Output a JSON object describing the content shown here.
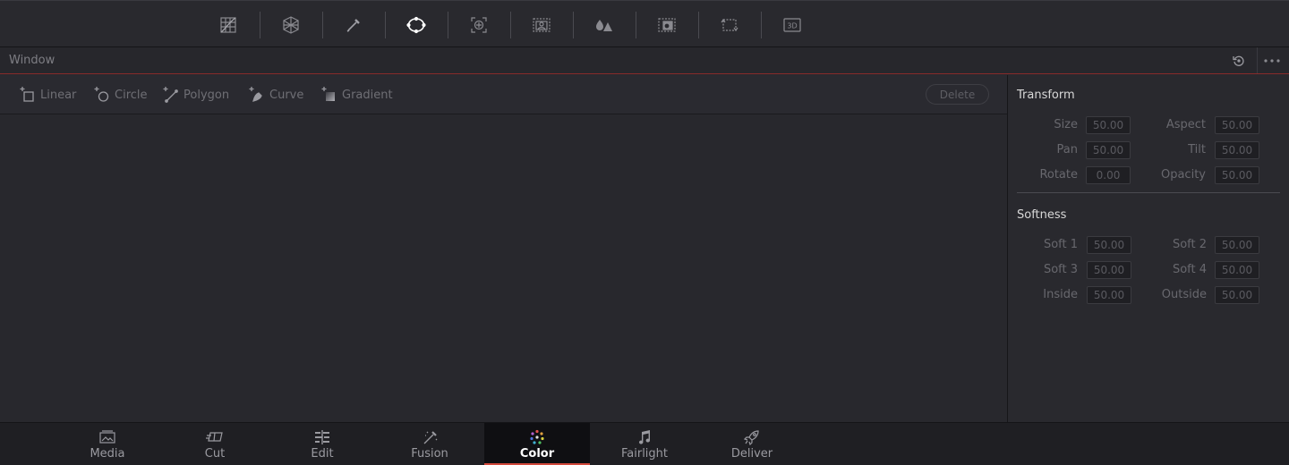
{
  "palette_toolbar": {
    "tools": [
      {
        "name": "curves-icon"
      },
      {
        "name": "warper-icon"
      },
      {
        "name": "qualifier-icon"
      },
      {
        "name": "window-icon",
        "active": true
      },
      {
        "name": "tracker-icon"
      },
      {
        "name": "magic-mask-icon"
      },
      {
        "name": "blur-icon"
      },
      {
        "name": "key-icon"
      },
      {
        "name": "sizing-icon"
      },
      {
        "name": "3d-icon",
        "text": "3D"
      }
    ]
  },
  "window_panel": {
    "title": "Window"
  },
  "shape_tools": {
    "linear": "Linear",
    "circle": "Circle",
    "polygon": "Polygon",
    "curve": "Curve",
    "gradient": "Gradient",
    "delete": "Delete"
  },
  "transform": {
    "title": "Transform",
    "size_label": "Size",
    "size_value": "50.00",
    "aspect_label": "Aspect",
    "aspect_value": "50.00",
    "pan_label": "Pan",
    "pan_value": "50.00",
    "tilt_label": "Tilt",
    "tilt_value": "50.00",
    "rotate_label": "Rotate",
    "rotate_value": "0.00",
    "opacity_label": "Opacity",
    "opacity_value": "50.00"
  },
  "softness": {
    "title": "Softness",
    "soft1_label": "Soft 1",
    "soft1_value": "50.00",
    "soft2_label": "Soft 2",
    "soft2_value": "50.00",
    "soft3_label": "Soft 3",
    "soft3_value": "50.00",
    "soft4_label": "Soft 4",
    "soft4_value": "50.00",
    "inside_label": "Inside",
    "inside_value": "50.00",
    "outside_label": "Outside",
    "outside_value": "50.00"
  },
  "pages": {
    "media": "Media",
    "cut": "Cut",
    "edit": "Edit",
    "fusion": "Fusion",
    "color": "Color",
    "fairlight": "Fairlight",
    "deliver": "Deliver",
    "active": "Color"
  },
  "colors": {
    "accent_red": "#d24a3c",
    "background": "#28282d"
  }
}
